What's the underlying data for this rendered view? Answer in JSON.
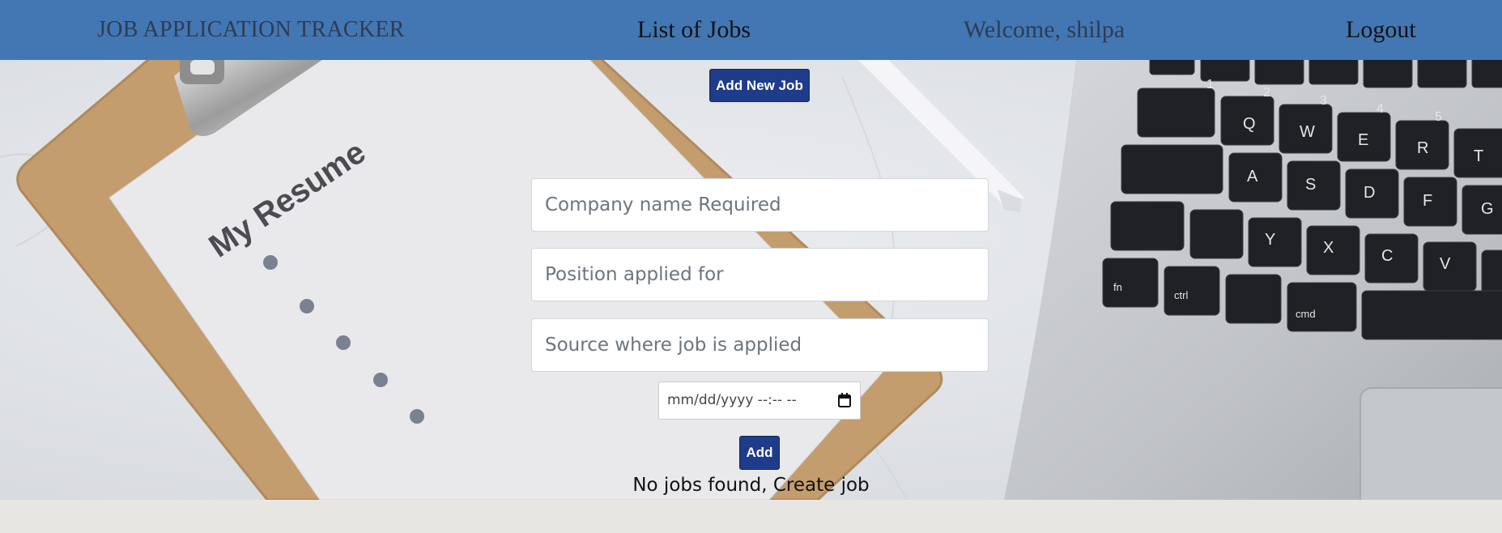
{
  "navbar": {
    "brand": "JOB APPLICATION TRACKER",
    "jobs_link": "List of Jobs",
    "welcome": "Welcome, shilpa",
    "logout": "Logout",
    "background_color": "#4277b3"
  },
  "background": {
    "resume_title": "My Resume"
  },
  "form": {
    "add_new_job_label": "Add New Job",
    "company_placeholder": "Company name Required",
    "position_placeholder": "Position applied for",
    "source_placeholder": "Source where job is applied",
    "date_placeholder": "mm/dd/yyyy --:-- --",
    "date_icon": "calendar-icon",
    "add_label": "Add",
    "button_color": "#1f3c8b"
  },
  "status": {
    "empty_message": "No jobs found, Create job"
  }
}
